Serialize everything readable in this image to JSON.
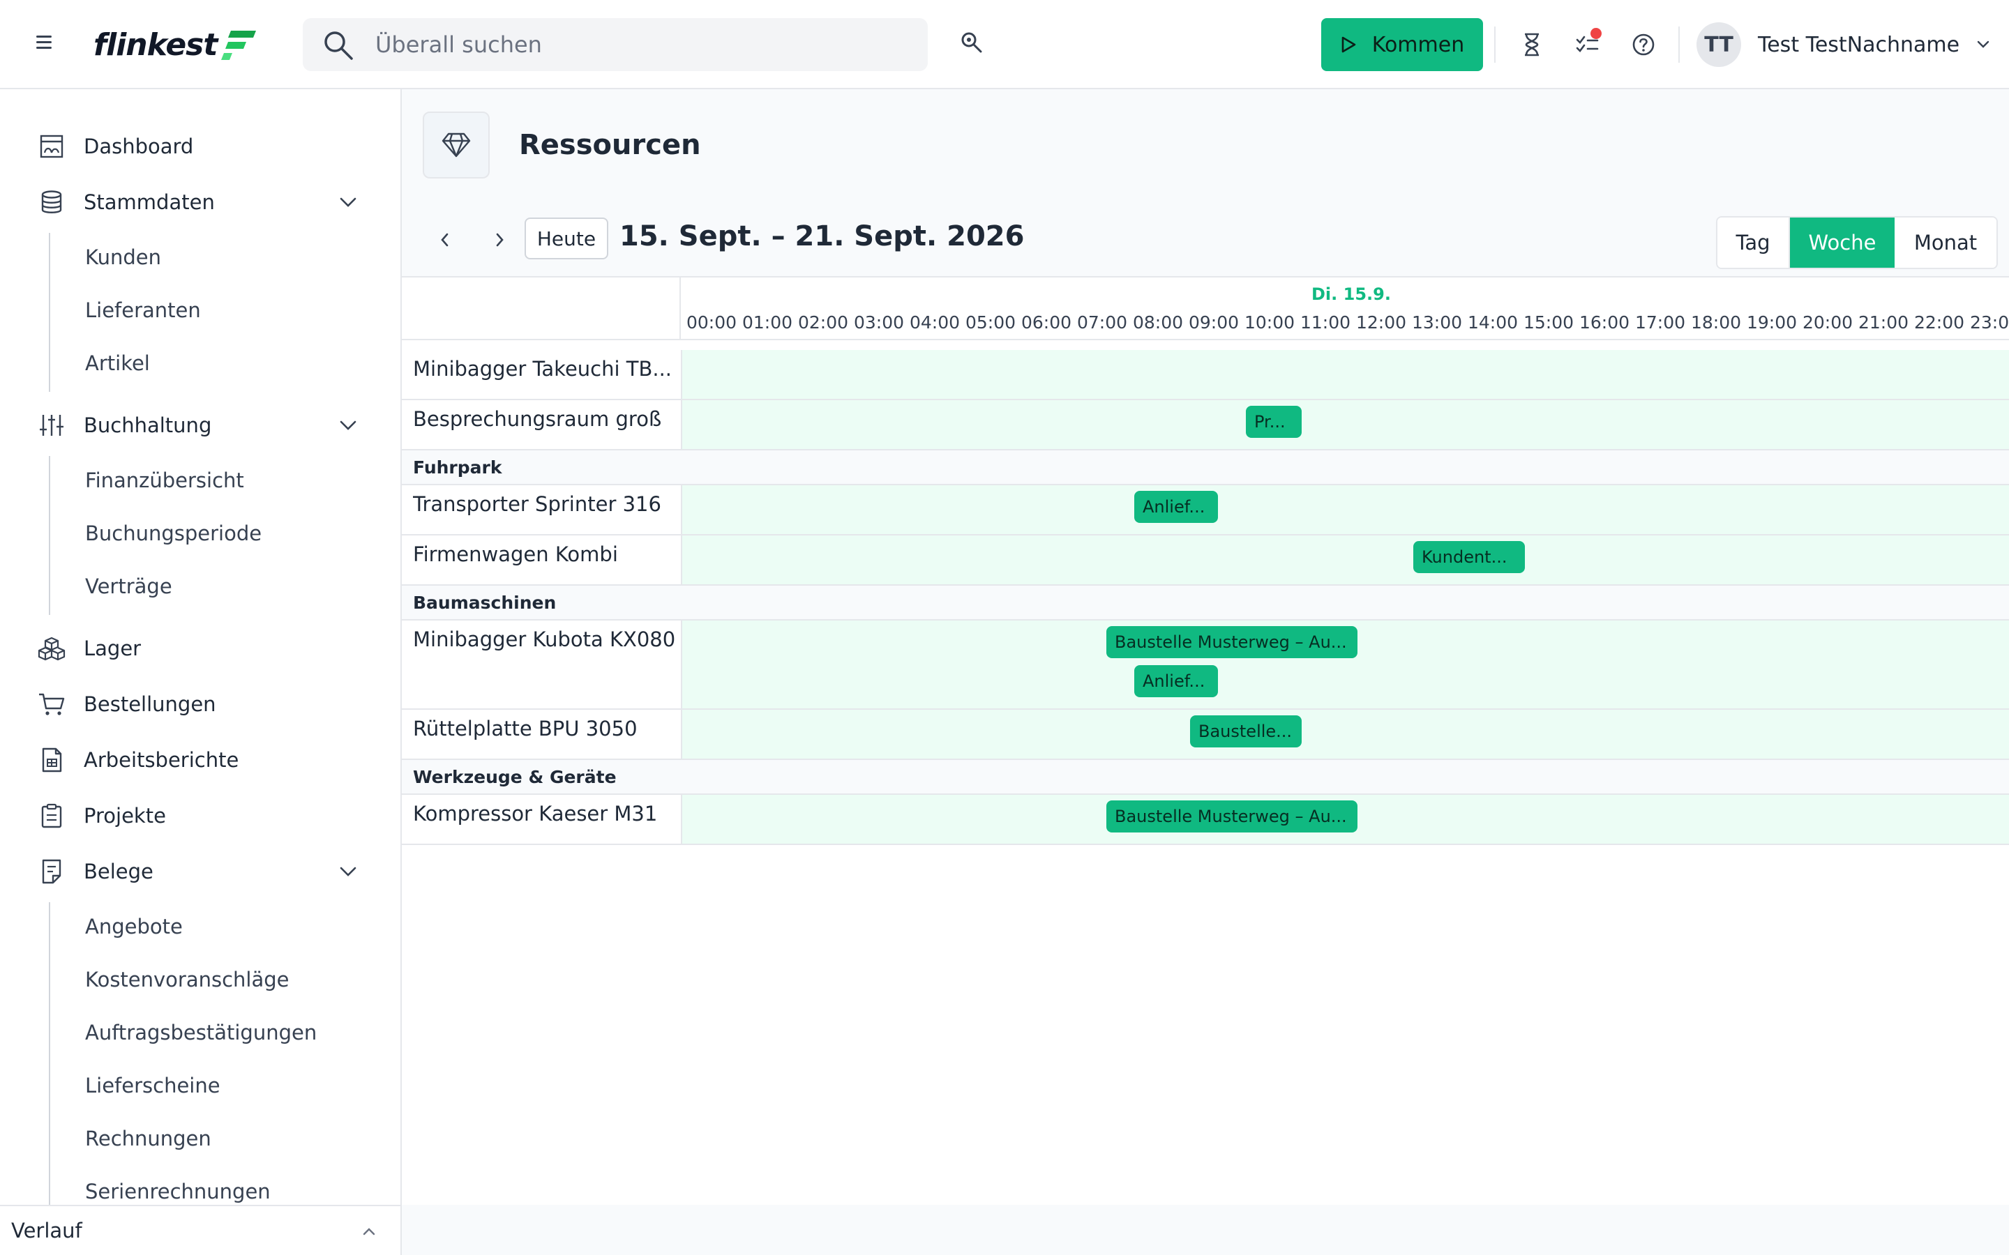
{
  "header": {
    "logo_text": "flinkest",
    "search_placeholder": "Überall suchen",
    "kommen_label": "Kommen",
    "user_initials": "TT",
    "user_name": "Test TestNachname",
    "accent_color": "#10b981"
  },
  "sidebar": {
    "items": [
      {
        "label": "Dashboard",
        "icon": "dashboard-icon"
      },
      {
        "label": "Stammdaten",
        "icon": "database-icon",
        "children": [
          "Kunden",
          "Lieferanten",
          "Artikel"
        ]
      },
      {
        "label": "Buchhaltung",
        "icon": "sliders-icon",
        "children": [
          "Finanzübersicht",
          "Buchungsperiode",
          "Verträge"
        ]
      },
      {
        "label": "Lager",
        "icon": "boxes-icon"
      },
      {
        "label": "Bestellungen",
        "icon": "cart-icon"
      },
      {
        "label": "Arbeitsberichte",
        "icon": "report-icon"
      },
      {
        "label": "Projekte",
        "icon": "clipboard-icon"
      },
      {
        "label": "Belege",
        "icon": "document-icon",
        "children": [
          "Angebote",
          "Kostenvoranschläge",
          "Auftragsbestätigungen",
          "Lieferscheine",
          "Rechnungen",
          "Serienrechnungen"
        ]
      }
    ],
    "footer_label": "Verlauf"
  },
  "page": {
    "title": "Ressourcen",
    "icon": "diamond-icon"
  },
  "toolbar": {
    "today_label": "Heute",
    "date_range": "15. Sept. – 21. Sept. 2026",
    "views": [
      "Tag",
      "Woche",
      "Monat"
    ],
    "active_view": "Woche"
  },
  "scheduler": {
    "day_label": "Di. 15.9.",
    "hours": [
      "00:00",
      "01:00",
      "02:00",
      "03:00",
      "04:00",
      "05:00",
      "06:00",
      "07:00",
      "08:00",
      "09:00",
      "10:00",
      "11:00",
      "12:00",
      "13:00",
      "14:00",
      "15:00",
      "16:00",
      "17:00",
      "18:00",
      "19:00",
      "20:00",
      "21:00",
      "22:00",
      "23:0"
    ],
    "rows": [
      {
        "type": "resource",
        "name": "Minibagger Takeuchi TB...",
        "events": []
      },
      {
        "type": "resource",
        "name": "Besprechungsraum groß",
        "events": [
          {
            "label": "Pr...",
            "start": "10:00",
            "end": "11:00"
          }
        ]
      },
      {
        "type": "group",
        "name": "Fuhrpark"
      },
      {
        "type": "resource",
        "name": "Transporter Sprinter 316",
        "events": [
          {
            "label": "Anlief...",
            "start": "08:00",
            "end": "09:30"
          }
        ]
      },
      {
        "type": "resource",
        "name": "Firmenwagen Kombi",
        "events": [
          {
            "label": "Kundent...",
            "start": "13:00",
            "end": "15:00"
          }
        ]
      },
      {
        "type": "group",
        "name": "Baumaschinen"
      },
      {
        "type": "resource",
        "name": "Minibagger Kubota KX080",
        "events": [
          {
            "label": "Baustelle Musterweg – Au...",
            "start": "07:30",
            "end": "12:00"
          },
          {
            "label": "Anlief...",
            "start": "08:00",
            "end": "09:30"
          }
        ]
      },
      {
        "type": "resource",
        "name": "Rüttelplatte BPU 3050",
        "events": [
          {
            "label": "Baustelle...",
            "start": "09:00",
            "end": "11:00"
          }
        ]
      },
      {
        "type": "group",
        "name": "Werkzeuge & Geräte"
      },
      {
        "type": "resource",
        "name": "Kompressor Kaeser M31",
        "events": [
          {
            "label": "Baustelle Musterweg – Au...",
            "start": "07:30",
            "end": "12:00"
          }
        ]
      }
    ]
  }
}
